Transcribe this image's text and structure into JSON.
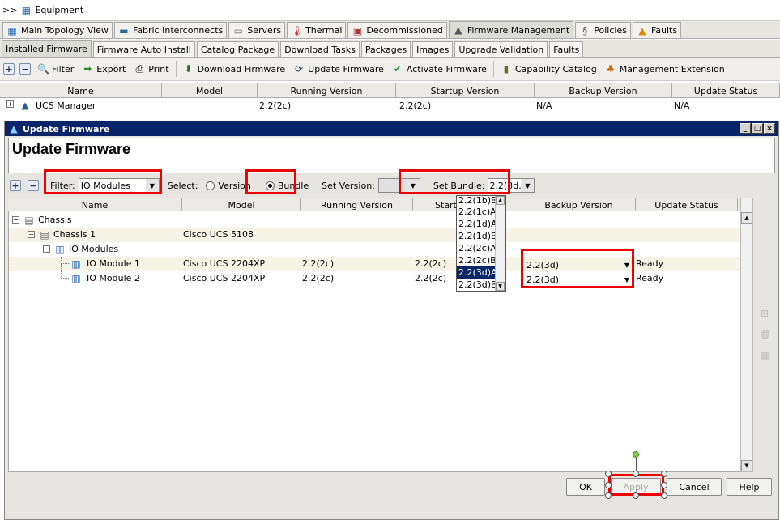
{
  "breadcrumb": {
    "prefix": ">>",
    "label": "Equipment"
  },
  "top_tabs": [
    {
      "label": "Main Topology View",
      "icon": "topology-icon"
    },
    {
      "label": "Fabric Interconnects",
      "icon": "fabric-interconnect-icon"
    },
    {
      "label": "Servers",
      "icon": "server-icon"
    },
    {
      "label": "Thermal",
      "icon": "thermometer-icon"
    },
    {
      "label": "Decommissioned",
      "icon": "decommission-icon"
    },
    {
      "label": "Firmware Management",
      "icon": "firmware-icon",
      "active": true
    },
    {
      "label": "Policies",
      "icon": "policy-icon"
    },
    {
      "label": "Faults",
      "icon": "fault-warning-icon"
    }
  ],
  "sub_tabs": [
    {
      "label": "Installed Firmware",
      "active": true
    },
    {
      "label": "Firmware Auto Install"
    },
    {
      "label": "Catalog Package"
    },
    {
      "label": "Download Tasks"
    },
    {
      "label": "Packages"
    },
    {
      "label": "Images"
    },
    {
      "label": "Upgrade Validation"
    },
    {
      "label": "Faults"
    }
  ],
  "toolbar": {
    "filter": "Filter",
    "export": "Export",
    "print": "Print",
    "download_firmware": "Download Firmware",
    "update_firmware": "Update Firmware",
    "activate_firmware": "Activate Firmware",
    "capability_catalog": "Capability Catalog",
    "management_extension": "Management Extension"
  },
  "main_grid": {
    "columns": [
      "Name",
      "Model",
      "Running Version",
      "Startup Version",
      "Backup Version",
      "Update Status"
    ],
    "row": {
      "name": "UCS Manager",
      "model": "",
      "running": "2.2(2c)",
      "startup": "2.2(2c)",
      "backup": "N/A",
      "status": "N/A"
    }
  },
  "dialog": {
    "window_title": "Update Firmware",
    "heading": "Update Firmware",
    "filter_label": "Filter:",
    "filter_value": "IO Modules",
    "select_label": "Select:",
    "version_option": "Version",
    "bundle_option": "Bundle",
    "selected_option": "Bundle",
    "set_version_label": "Set Version:",
    "set_version_value": "",
    "set_bundle_label": "Set Bundle:",
    "set_bundle_value": "2.2(3d...",
    "columns": [
      "Name",
      "Model",
      "Running Version",
      "Startup Version",
      "Backup Version",
      "Update Status"
    ],
    "startup_header_visible": "Start",
    "tree": [
      {
        "name": "Chassis",
        "model": "",
        "running": "",
        "startup": "",
        "backup": "",
        "status": ""
      },
      {
        "name": "Chassis 1",
        "model": "Cisco UCS 5108",
        "running": "",
        "startup": "",
        "backup": "",
        "status": ""
      },
      {
        "name": "IO Modules",
        "model": "",
        "running": "",
        "startup": "",
        "backup": "",
        "status": ""
      },
      {
        "name": "IO Module 1",
        "model": "Cisco UCS 2204XP",
        "running": "2.2(2c)",
        "startup": "2.2(2c)",
        "backup": "2.2(3d)",
        "status": "Ready"
      },
      {
        "name": "IO Module 2",
        "model": "Cisco UCS 2204XP",
        "running": "2.2(2c)",
        "startup": "2.2(2c)",
        "backup": "2.2(3d)",
        "status": "Ready"
      }
    ],
    "bundle_options": [
      "2.2(1b)B",
      "2.2(1c)A",
      "2.2(1d)A",
      "2.2(1d)B",
      "2.2(2c)A",
      "2.2(2c)B",
      "2.2(3d)A",
      "2.2(3d)B"
    ],
    "bundle_selected": "2.2(3d)A",
    "buttons": {
      "ok": "OK",
      "apply": "Apply",
      "cancel": "Cancel",
      "help": "Help"
    }
  },
  "colors": {
    "title_bar": "#0a246a",
    "highlight_box": "#e00000",
    "selection": "#0a246a"
  }
}
